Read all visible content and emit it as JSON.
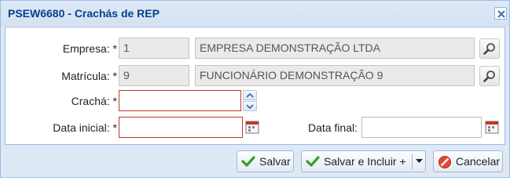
{
  "window": {
    "title": "PSEW6680 - Crachás de REP"
  },
  "form": {
    "empresa": {
      "label": "Empresa: *",
      "code": "1",
      "name": "EMPRESA DEMONSTRAÇÃO LTDA"
    },
    "matricula": {
      "label": "Matrícula: *",
      "code": "9",
      "name": "FUNCIONÁRIO DEMONSTRAÇÃO 9"
    },
    "cracha": {
      "label": "Crachá: *",
      "value": ""
    },
    "data_inicial": {
      "label": "Data inicial: *",
      "value": ""
    },
    "data_final": {
      "label": "Data final:",
      "value": ""
    }
  },
  "buttons": {
    "salvar": "Salvar",
    "salvar_incluir": "Salvar e Incluir +",
    "cancelar": "Cancelar"
  },
  "colors": {
    "title": "#04408c",
    "required_border": "#c0392b",
    "panel_bg": "#dfe9f6"
  }
}
